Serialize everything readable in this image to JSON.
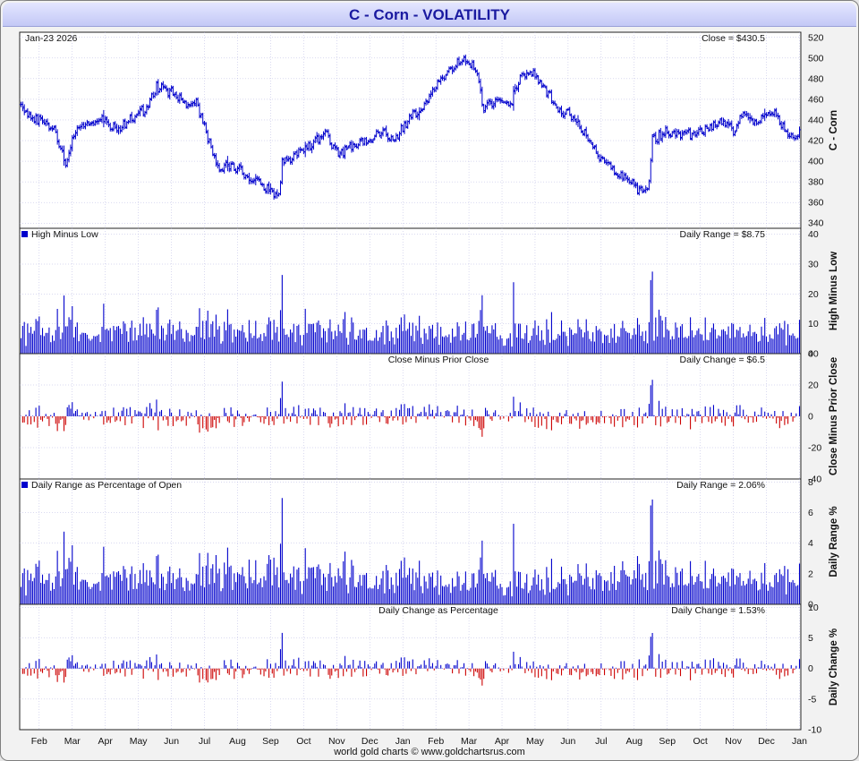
{
  "header": {
    "title": "C  -  Corn - VOLATILITY"
  },
  "footer": "world gold charts © www.goldchartsrus.com",
  "chart_data": {
    "type": "volatility-dashboard",
    "date_label": "Jan-23  2026",
    "months": [
      "Feb",
      "Mar",
      "Apr",
      "May",
      "Jun",
      "Jul",
      "Aug",
      "Sep",
      "Oct",
      "Nov",
      "Dec",
      "Jan",
      "Feb",
      "Mar",
      "Apr",
      "May",
      "Jun",
      "Jul",
      "Aug",
      "Sep",
      "Oct",
      "Nov",
      "Dec",
      "Jan"
    ],
    "price_path": [
      [
        0,
        455
      ],
      [
        6,
        443
      ],
      [
        12,
        440
      ],
      [
        20,
        430
      ],
      [
        27,
        400
      ],
      [
        32,
        428
      ],
      [
        40,
        440
      ],
      [
        50,
        440
      ],
      [
        58,
        430
      ],
      [
        66,
        440
      ],
      [
        76,
        452
      ],
      [
        82,
        472
      ],
      [
        92,
        466
      ],
      [
        100,
        455
      ],
      [
        106,
        458
      ],
      [
        112,
        428
      ],
      [
        118,
        395
      ],
      [
        128,
        395
      ],
      [
        138,
        385
      ],
      [
        148,
        375
      ],
      [
        156,
        365
      ],
      [
        158,
        398
      ],
      [
        168,
        408
      ],
      [
        178,
        420
      ],
      [
        184,
        428
      ],
      [
        192,
        406
      ],
      [
        200,
        414
      ],
      [
        208,
        420
      ],
      [
        218,
        430
      ],
      [
        226,
        420
      ],
      [
        234,
        440
      ],
      [
        244,
        455
      ],
      [
        254,
        480
      ],
      [
        262,
        493
      ],
      [
        270,
        500
      ],
      [
        276,
        486
      ],
      [
        280,
        450
      ],
      [
        288,
        460
      ],
      [
        296,
        454
      ],
      [
        302,
        482
      ],
      [
        310,
        485
      ],
      [
        318,
        468
      ],
      [
        326,
        450
      ],
      [
        336,
        442
      ],
      [
        342,
        425
      ],
      [
        350,
        405
      ],
      [
        358,
        392
      ],
      [
        366,
        384
      ],
      [
        374,
        372
      ],
      [
        380,
        378
      ],
      [
        382,
        420
      ],
      [
        390,
        428
      ],
      [
        400,
        424
      ],
      [
        408,
        428
      ],
      [
        416,
        432
      ],
      [
        424,
        440
      ],
      [
        432,
        428
      ],
      [
        436,
        446
      ],
      [
        444,
        440
      ],
      [
        452,
        445
      ],
      [
        456,
        448
      ],
      [
        462,
        430
      ],
      [
        470,
        424
      ]
    ],
    "latest": {
      "close": 430.5,
      "high_minus_low": 8.75,
      "close_minus_prior_close": 6.5,
      "range_pct_of_open": 2.06,
      "change_pct": 1.53
    },
    "panels": [
      {
        "id": "price",
        "legend": "",
        "right_label": "Close = $430.5",
        "axis_title": "C  -  Corn",
        "ticks": [
          340,
          360,
          380,
          400,
          420,
          440,
          460,
          480,
          500,
          520
        ],
        "ylim": [
          335,
          525
        ]
      },
      {
        "id": "high_minus_low",
        "legend": "High Minus Low",
        "right_label": "Daily Range = $8.75",
        "axis_title": "High Minus Low",
        "ticks": [
          0,
          10,
          20,
          30,
          40
        ],
        "ylim": [
          0,
          42
        ]
      },
      {
        "id": "close_minus_prior_close",
        "legend": "Close Minus Prior Close",
        "right_label": "Daily Change = $6.5",
        "axis_title": "Close Minus Prior Close",
        "ticks": [
          -40,
          -20,
          0,
          20,
          40
        ],
        "ylim": [
          -40,
          40
        ]
      },
      {
        "id": "range_pct_of_open",
        "legend": "Daily Range as Percentage of Open",
        "right_label": "Daily Range = 2.06%",
        "axis_title": "Daily Range %",
        "ticks": [
          0,
          2,
          4,
          6,
          8
        ],
        "ylim": [
          0,
          8.2
        ]
      },
      {
        "id": "change_pct",
        "legend": "Daily Change as Percentage",
        "right_label": "Daily Change = 1.53%",
        "axis_title": "Daily Change %",
        "ticks": [
          -10,
          -5,
          0,
          5,
          10
        ],
        "ylim": [
          -10,
          10.5
        ]
      }
    ],
    "colors": {
      "up": "#0000cc",
      "down": "#cc0000",
      "grid": "#b4b4e0",
      "legend_box": "#0000cc"
    }
  }
}
